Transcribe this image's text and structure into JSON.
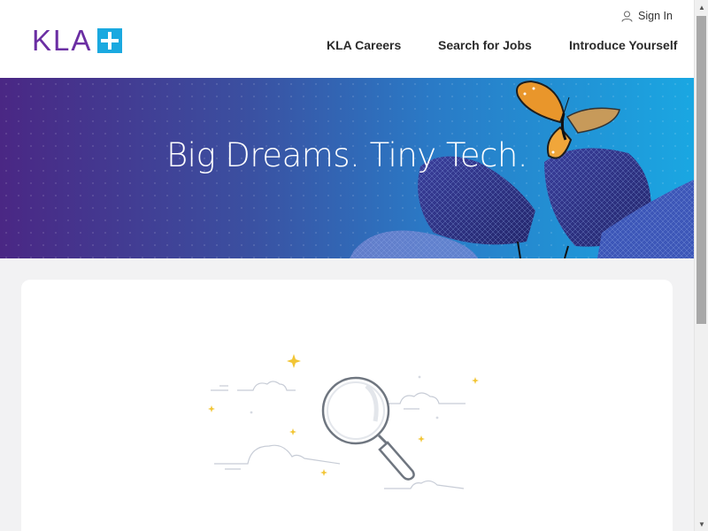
{
  "brand": {
    "logo_text": "KLA",
    "logo_plus_color": "#1aa9e0",
    "logo_text_color": "#6b2fa3"
  },
  "header": {
    "sign_in_label": "Sign In",
    "nav": [
      {
        "label": "KLA Careers"
      },
      {
        "label": "Search for Jobs"
      },
      {
        "label": "Introduce Yourself"
      }
    ]
  },
  "banner": {
    "title": "Big Dreams. Tiny Tech.",
    "gradient_start": "#4a2784",
    "gradient_end": "#1aa7e2"
  },
  "content": {
    "illustration_icon": "magnifying-glass-icon"
  },
  "colors": {
    "page_bg": "#f2f2f3",
    "card_bg": "#ffffff"
  }
}
